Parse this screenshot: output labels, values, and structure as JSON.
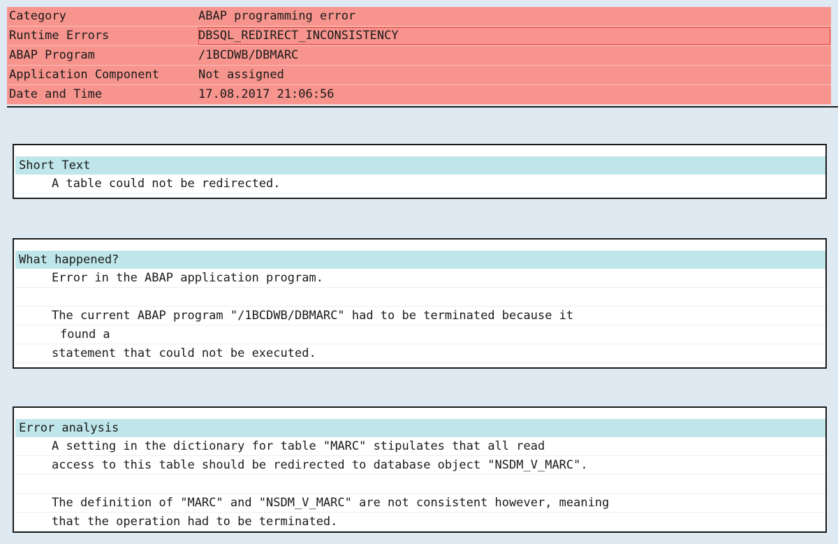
{
  "header": {
    "rows": [
      {
        "key": "Category",
        "value": "ABAP programming error"
      },
      {
        "key": "Runtime Errors",
        "value": "DBSQL_REDIRECT_INCONSISTENCY"
      },
      {
        "key": "ABAP Program",
        "value": "/1BCDWB/DBMARC"
      },
      {
        "key": "Application Component",
        "value": "Not assigned"
      },
      {
        "key": "Date and Time",
        "value": "17.08.2017 21:06:56"
      }
    ]
  },
  "sections": {
    "short_text": {
      "title": "Short Text",
      "lines": [
        "A table could not be redirected."
      ]
    },
    "what_happened": {
      "title": "What happened?",
      "lines": [
        "Error in the ABAP application program.",
        "",
        "The current ABAP program \"/1BCDWB/DBMARC\" had to be terminated because it",
        "found a",
        "statement that could not be executed."
      ]
    },
    "error_analysis": {
      "title": "Error analysis",
      "lines": [
        "A setting in the dictionary for table \"MARC\" stipulates that all read",
        "access to this table should be redirected to database object \"NSDM_V_MARC\".",
        "",
        "The definition of \"MARC\" and \"NSDM_V_MARC\" are not consistent however, meaning",
        "that the operation had to be terminated."
      ]
    }
  },
  "colors": {
    "header_bg": "#f7948d",
    "section_title_bg": "#bfe6ea",
    "page_bg": "#dfe9f2"
  }
}
